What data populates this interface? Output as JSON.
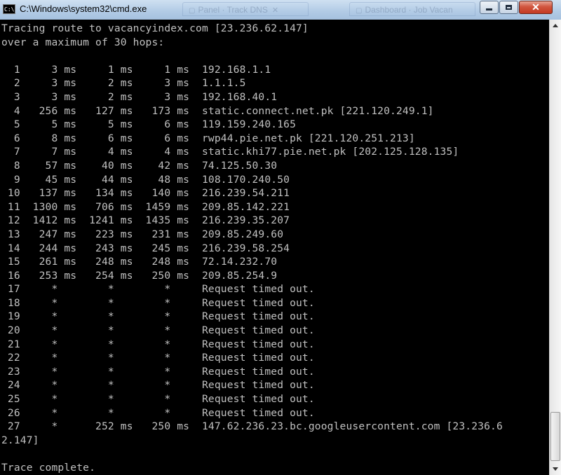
{
  "window": {
    "title": "C:\\Windows\\system32\\cmd.exe",
    "app_icon": "cmd-icon",
    "app_icon_text": "C:\\",
    "controls": {
      "minimize": "minimize-icon",
      "maximize": "maximize-icon",
      "close": "close-icon",
      "close_glyph": "✕"
    }
  },
  "background_tabs": [
    {
      "label": "Panel · Track DNS"
    },
    {
      "label": "Dashboard · Job Vacan"
    }
  ],
  "console": {
    "lines": [
      "Tracing route to vacancyindex.com [23.236.62.147]",
      "over a maximum of 30 hops:",
      "",
      "  1     3 ms     1 ms     1 ms  192.168.1.1",
      "  2     3 ms     2 ms     3 ms  1.1.1.5",
      "  3     3 ms     2 ms     3 ms  192.168.40.1",
      "  4   256 ms   127 ms   173 ms  static.connect.net.pk [221.120.249.1]",
      "  5     5 ms     5 ms     6 ms  119.159.240.165",
      "  6     8 ms     6 ms     6 ms  rwp44.pie.net.pk [221.120.251.213]",
      "  7     7 ms     4 ms     4 ms  static.khi77.pie.net.pk [202.125.128.135]",
      "  8    57 ms    40 ms    42 ms  74.125.50.30",
      "  9    45 ms    44 ms    48 ms  108.170.240.50",
      " 10   137 ms   134 ms   140 ms  216.239.54.211",
      " 11  1300 ms   706 ms  1459 ms  209.85.142.221",
      " 12  1412 ms  1241 ms  1435 ms  216.239.35.207",
      " 13   247 ms   223 ms   231 ms  209.85.249.60",
      " 14   244 ms   243 ms   245 ms  216.239.58.254",
      " 15   261 ms   248 ms   248 ms  72.14.232.70",
      " 16   253 ms   254 ms   250 ms  209.85.254.9",
      " 17     *        *        *     Request timed out.",
      " 18     *        *        *     Request timed out.",
      " 19     *        *        *     Request timed out.",
      " 20     *        *        *     Request timed out.",
      " 21     *        *        *     Request timed out.",
      " 22     *        *        *     Request timed out.",
      " 23     *        *        *     Request timed out.",
      " 24     *        *        *     Request timed out.",
      " 25     *        *        *     Request timed out.",
      " 26     *        *        *     Request timed out.",
      " 27     *      252 ms   250 ms  147.62.236.23.bc.googleusercontent.com [23.236.6",
      "2.147]",
      "",
      "Trace complete."
    ]
  },
  "scrollbar": {
    "up_icon": "scroll-up-arrow-icon",
    "down_icon": "scroll-down-arrow-icon"
  }
}
